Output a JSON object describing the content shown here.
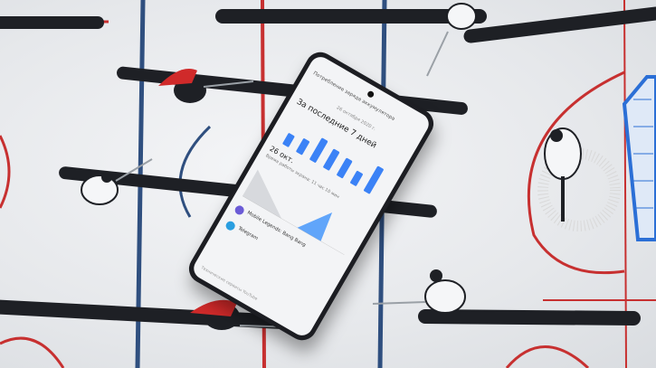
{
  "scene": {
    "description_colors": {
      "board": "#eceef1",
      "rod": "#1e2025",
      "blue_line": "#2f4f7f",
      "red_line": "#c73030",
      "goal_frame": "#2b6fd6",
      "player_red": "#d02a2a",
      "player_white": "#f5f6f8",
      "phone_body": "#1c1d22",
      "chart_bar": "#3b82f6"
    }
  },
  "phone": {
    "header": "Потребление заряда аккумулятора",
    "date_range": "26 октября 2020 г.",
    "period_title": "За последние 7 дней",
    "selected_day": "26 окт.",
    "usage_time": "Время работы экрана: 11 час 10 мин",
    "apps": [
      {
        "name": "Mobile Legends: Bang Bang",
        "icon": "game-icon",
        "color": "#6b5bd6"
      },
      {
        "name": "Telegram",
        "icon": "telegram-icon",
        "color": "#2a9ee0"
      }
    ],
    "footer": "Технические сервисы YouTube",
    "chart_data": {
      "type": "bar",
      "categories": [
        "",
        "",
        "",
        "",
        "",
        "",
        ""
      ],
      "values": [
        18,
        22,
        35,
        30,
        28,
        20,
        40
      ]
    }
  }
}
